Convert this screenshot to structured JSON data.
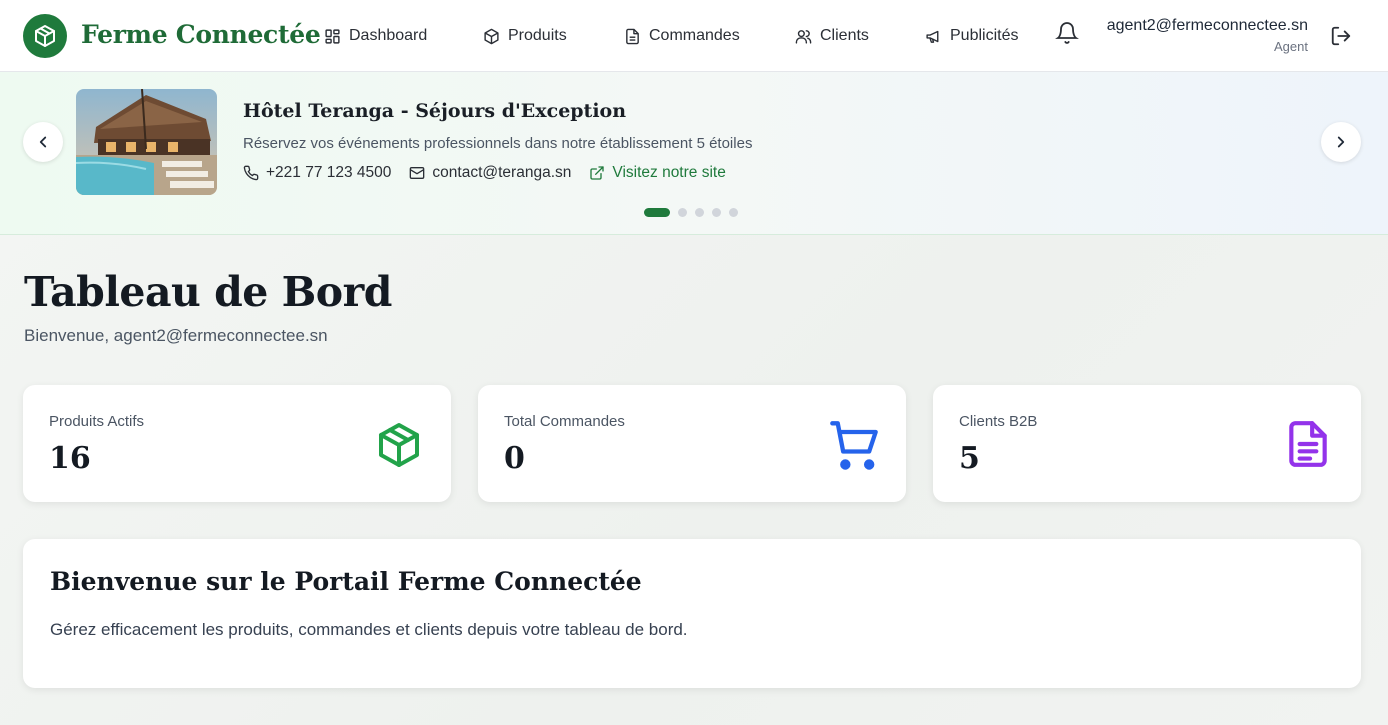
{
  "brand": {
    "name": "Ferme Connectée",
    "logo_icon": "package-icon",
    "color": "#1f7a3c"
  },
  "nav": [
    {
      "label": "Dashboard",
      "icon": "grid-icon"
    },
    {
      "label": "Produits",
      "icon": "package-icon"
    },
    {
      "label": "Commandes",
      "icon": "document-icon"
    },
    {
      "label": "Clients",
      "icon": "users-icon"
    },
    {
      "label": "Publicités",
      "icon": "megaphone-icon"
    }
  ],
  "user": {
    "email": "agent2@fermeconnectee.sn",
    "role": "Agent"
  },
  "banner": {
    "title": "Hôtel Teranga - Séjours d'Exception",
    "description": "Réservez vos événements professionnels dans notre établissement 5 étoiles",
    "phone": "+221 77 123 4500",
    "email": "contact@teranga.sn",
    "link_label": "Visitez notre site",
    "slides": 5,
    "active_slide": 1
  },
  "page": {
    "title": "Tableau de Bord",
    "welcome": "Bienvenue, agent2@fermeconnectee.sn"
  },
  "stats": [
    {
      "label": "Produits Actifs",
      "value": "16",
      "icon": "package-icon",
      "color": "#22a34a"
    },
    {
      "label": "Total Commandes",
      "value": "0",
      "icon": "cart-icon",
      "color": "#2563eb"
    },
    {
      "label": "Clients B2B",
      "value": "5",
      "icon": "document-icon",
      "color": "#9333ea"
    }
  ],
  "info": {
    "title": "Bienvenue sur le Portail Ferme Connectée",
    "text": "Gérez efficacement les produits, commandes et clients depuis votre tableau de bord."
  }
}
